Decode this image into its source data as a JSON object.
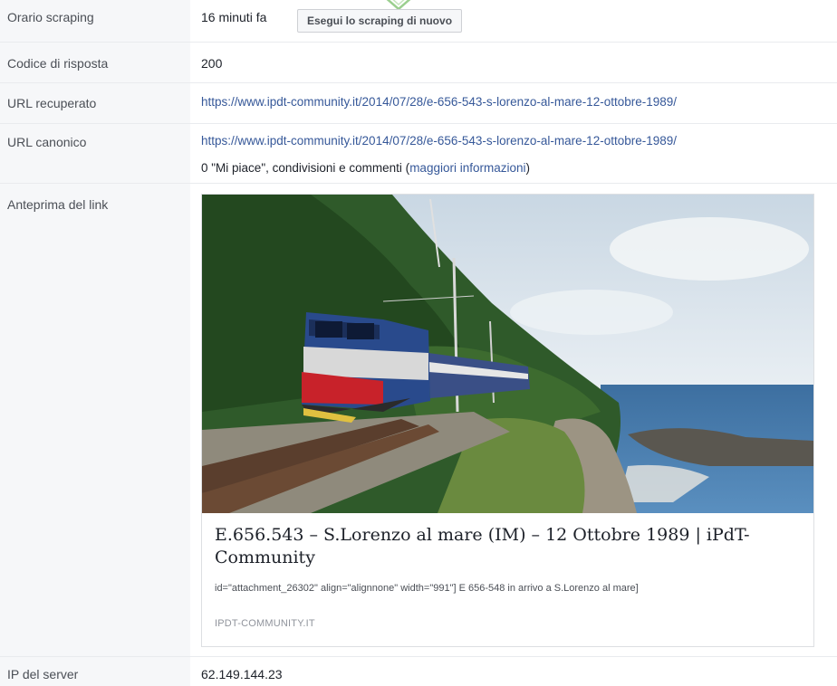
{
  "rows": {
    "scrape_time": {
      "label": "Orario scraping",
      "value": "16 minuti fa",
      "button": "Esegui lo scraping di nuovo"
    },
    "response_code": {
      "label": "Codice di risposta",
      "value": "200"
    },
    "fetched_url": {
      "label": "URL recuperato",
      "value": "https://www.ipdt-community.it/2014/07/28/e-656-543-s-lorenzo-al-mare-12-ottobre-1989/"
    },
    "canonical_url": {
      "label": "URL canonico",
      "value": "https://www.ipdt-community.it/2014/07/28/e-656-543-s-lorenzo-al-mare-12-ottobre-1989/",
      "engagement_text": "0 \"Mi piace\", condivisioni e commenti (",
      "engagement_link": "maggiori informazioni",
      "engagement_close": ")"
    },
    "link_preview": {
      "label": "Anteprima del link",
      "title": "E.656.543 – S.Lorenzo al mare (IM) – 12 Ottobre 1989 | iPdT-Community",
      "description": "id=\"attachment_26302\" align=\"alignnone\" width=\"991\"] E 656-548 in arrivo a S.Lorenzo al mare]",
      "domain": "IPDT-COMMUNITY.IT"
    },
    "server_ip": {
      "label": "IP del server",
      "value": "62.149.144.23"
    }
  },
  "colors": {
    "link": "#365899",
    "label_bg": "#f6f7f9",
    "border": "#dddfe2"
  },
  "icons": {
    "top_icon": "shield-icon"
  }
}
